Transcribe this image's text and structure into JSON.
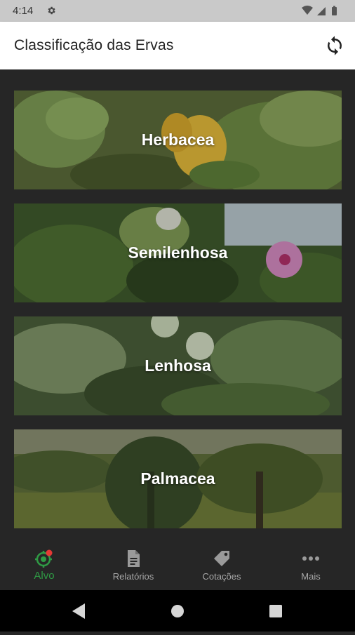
{
  "status_bar": {
    "time": "4:14"
  },
  "app_bar": {
    "title": "Classificação das Ervas",
    "refresh_icon": "refresh-icon"
  },
  "cards": [
    {
      "label": "Herbacea"
    },
    {
      "label": "Semilenhosa"
    },
    {
      "label": "Lenhosa"
    },
    {
      "label": "Palmacea"
    }
  ],
  "bottom_nav": [
    {
      "label": "Alvo",
      "icon": "target-icon",
      "active": true
    },
    {
      "label": "Relatórios",
      "icon": "document-icon",
      "active": false
    },
    {
      "label": "Cotações",
      "icon": "tag-icon",
      "active": false
    },
    {
      "label": "Mais",
      "icon": "more-icon",
      "active": false
    }
  ],
  "colors": {
    "accent": "#2f9b45",
    "badge": "#e53935",
    "background": "#262626"
  }
}
